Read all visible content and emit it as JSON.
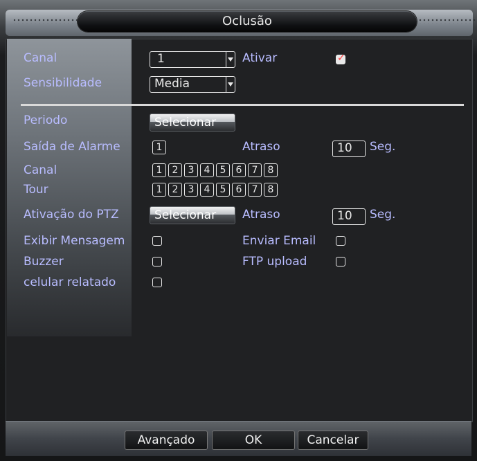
{
  "title": "Oclusão",
  "fields": {
    "canal_label": "Canal",
    "canal_value": "1",
    "ativar_label": "Ativar",
    "sens_label": "Sensibilidade",
    "sens_value": "Media",
    "periodo_label": "Periodo",
    "selecionar_label": "Selecionar",
    "saida_label": "Saída de Alarme",
    "saida_value": "1",
    "atraso_label": "Atraso",
    "atraso_value": "10",
    "seg_label": "Seg.",
    "canal2_label": "Canal",
    "tour_label": "Tour",
    "ptz_label": "Ativação do PTZ",
    "ptz_button": "Selecionar",
    "atraso2_label": "Atraso",
    "atraso2_value": "10",
    "seg2_label": "Seg.",
    "exibir_label": "Exibir Mensagem",
    "enviar_label": "Enviar Email",
    "buzzer_label": "Buzzer",
    "ftp_label": "FTP upload",
    "celular_label": "celular relatado"
  },
  "numbers": [
    "1",
    "2",
    "3",
    "4",
    "5",
    "6",
    "7",
    "8"
  ],
  "footer": {
    "avancado": "Avançado",
    "ok": "OK",
    "cancelar": "Cancelar"
  },
  "colors": {
    "label": "#b8bcff",
    "value": "#e9e9e9",
    "checked": "#ff3b3b"
  }
}
